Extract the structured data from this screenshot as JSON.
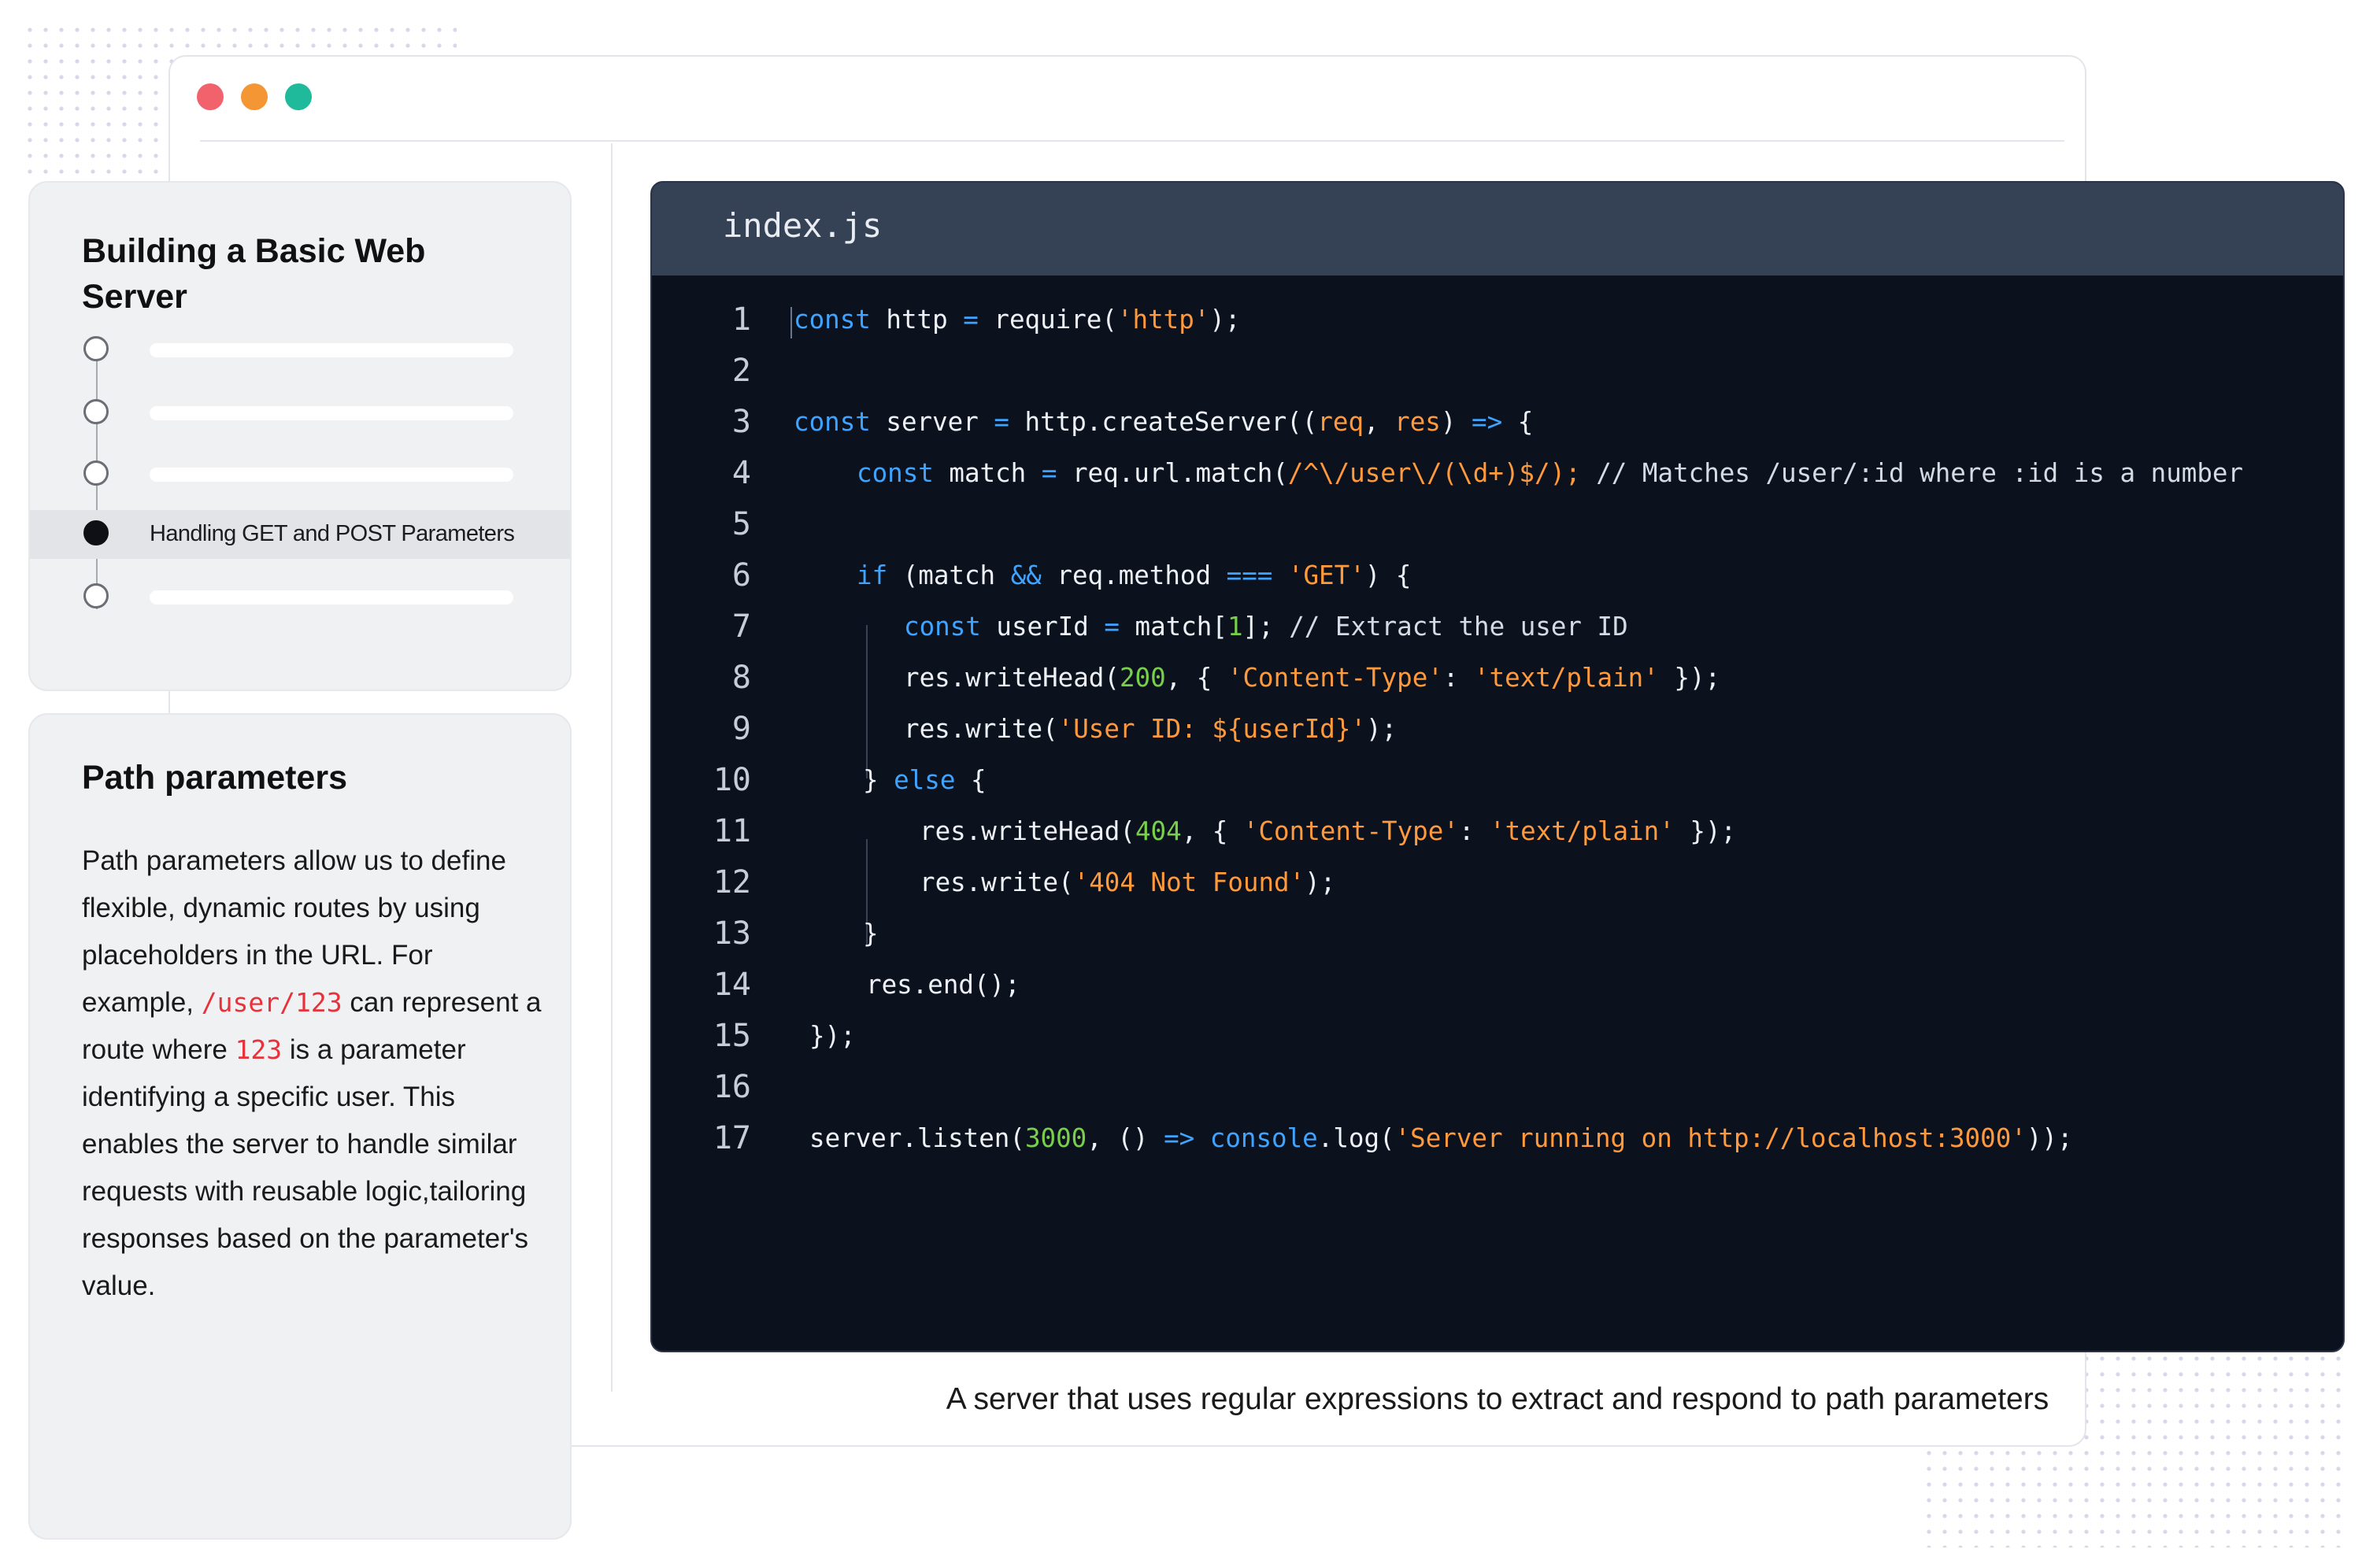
{
  "window": {
    "traffic_lights": {
      "close": "#f1626d",
      "minimize": "#f49634",
      "maximize": "#1fb99c"
    }
  },
  "toc": {
    "title": "Building a Basic Web Server",
    "items": [
      {
        "label": "",
        "active": false
      },
      {
        "label": "",
        "active": false
      },
      {
        "label": "",
        "active": false
      },
      {
        "label": "Handling GET and POST Parameters",
        "active": true
      },
      {
        "label": "",
        "active": false
      }
    ]
  },
  "path_card": {
    "title": "Path parameters",
    "text_1": "Path parameters allow us to define flexible, dynamic routes by using placeholders in the URL. For example,",
    "code_1": "/user/123",
    "text_2": "can represent a route where",
    "code_2": "123",
    "text_3": "is a parameter identifying a specific user. This enables the server to handle similar requests with reusable logic,tailoring responses based on the parameter's value."
  },
  "editor": {
    "filename": "index.js",
    "line_numbers": [
      "1",
      "2",
      "3",
      "4",
      "5",
      "6",
      "7",
      "8",
      "9",
      "10",
      "11",
      "12",
      "13",
      "14",
      "15",
      "16",
      "17"
    ],
    "code_lines": [
      "const http = require('http');",
      "",
      "const server = http.createServer((req, res) => {",
      "const match = req.url.match(/^\\/user\\/(\\d+)$/); // Matches /user/:id where :id is a number",
      "",
      "if (match && req.method === 'GET') {",
      "const userId = match[1]; // Extract the user ID",
      "res.writeHead(200, { 'Content-Type': 'text/plain' });",
      "res.write('User ID: ${userId}');",
      "} else {",
      "res.writeHead(404, { 'Content-Type': 'text/plain' });",
      "res.write('404 Not Found');",
      "}",
      "res.end();",
      "});",
      "",
      "server.listen(3000, () => console.log('Server running on http://localhost:3000'));"
    ],
    "colors": {
      "keyword": "#3fa4ff",
      "string": "#ff9a3c",
      "number": "#78d04a",
      "background": "#0c111e",
      "header": "#354256"
    }
  },
  "caption": "A server that uses regular expressions to extract and respond to path parameters"
}
